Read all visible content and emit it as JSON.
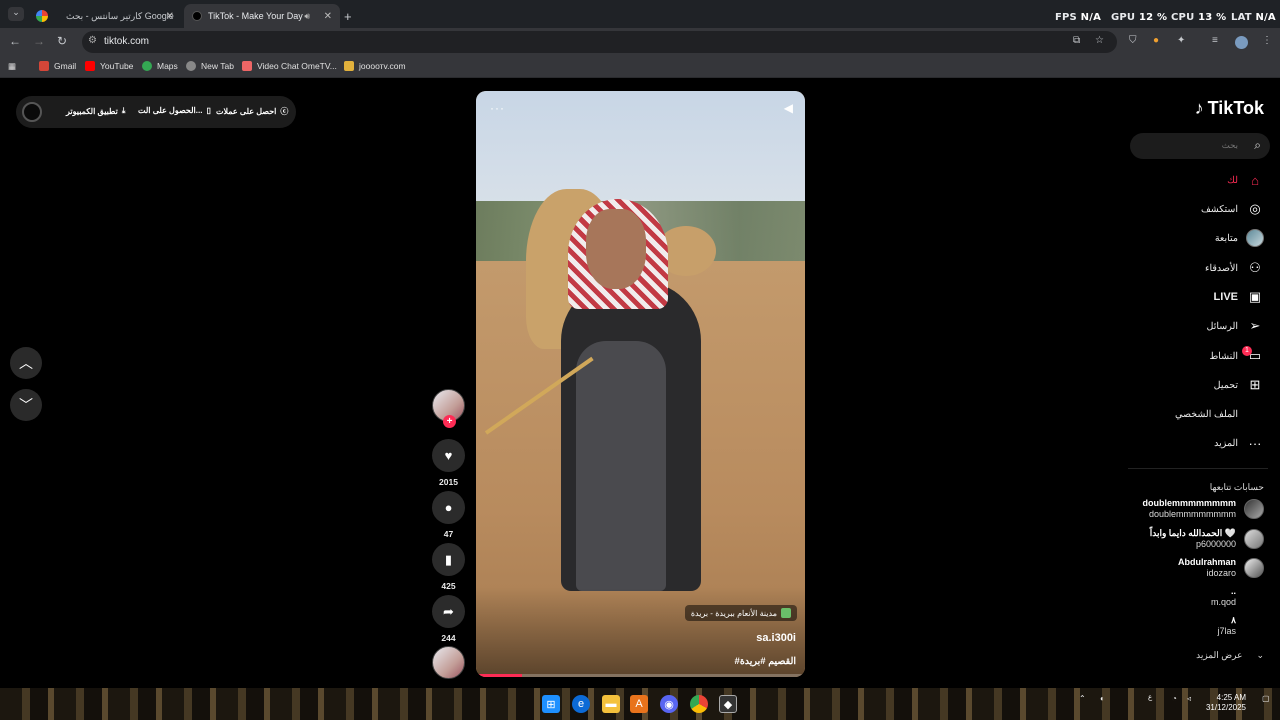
{
  "browser": {
    "tabs": [
      {
        "title": "کارتیر سانتس - بحث Google",
        "active": false
      },
      {
        "title": "TikTok - Make Your Day",
        "active": true
      }
    ],
    "new_tab": "+",
    "hud": {
      "fps_label": "FPS",
      "fps": "N/A",
      "gpu_label": "GPU",
      "gpu": "12 %",
      "cpu_label": "CPU",
      "cpu": "13 %",
      "lat_label": "LAT",
      "lat": "N/A"
    },
    "url": "tiktok.com",
    "bookmarks": [
      "Gmail",
      "YouTube",
      "Maps",
      "New Tab",
      "Video Chat OmeTV...",
      "joooотv.com"
    ]
  },
  "top_pill": {
    "get_coins": "احصل على عملات",
    "get_app": "الحصول على الت...",
    "desktop_app": "تطبيق الكمبيوتر"
  },
  "video": {
    "more": "···",
    "location": "مدينة الأنعام ببريدة - بريدة",
    "author": "sa.i300i",
    "caption": "#القصيم #بريدة",
    "progress": 0.14
  },
  "actions": {
    "likes": "2015",
    "comments": "47",
    "saves": "425",
    "shares": "244"
  },
  "sidebar": {
    "logo": "TikTok",
    "search_placeholder": "بحث",
    "items": [
      {
        "label": "لك",
        "icon": "home-icon"
      },
      {
        "label": "استكشف",
        "icon": "compass-icon"
      },
      {
        "label": "متابعة",
        "icon": "avatar"
      },
      {
        "label": "الأصدقاء",
        "icon": "friends-icon"
      },
      {
        "label": "LIVE",
        "icon": "live-icon"
      },
      {
        "label": "الرسائل",
        "icon": "send-icon"
      },
      {
        "label": "النشاط",
        "icon": "activity-icon",
        "badge": "1"
      },
      {
        "label": "تحميل",
        "icon": "upload-icon"
      },
      {
        "label": "الملف الشخصي",
        "icon": "profile-icon"
      },
      {
        "label": "المزيد",
        "icon": "more-icon"
      }
    ],
    "following_title": "حسابات تتابعها",
    "following": [
      {
        "name": "doublemmmmmmmm",
        "handle": "doublemmmmmmmm"
      },
      {
        "name": "الحمدالله دايما وابداً 🤍",
        "handle": "p6000000"
      },
      {
        "name": "Abdulrahman",
        "handle": "idozaro"
      },
      {
        "name": "..",
        "handle": "m.qod"
      },
      {
        "name": "٨",
        "handle": "j7las"
      }
    ],
    "see_more": "عرض المزيد"
  },
  "taskbar": {
    "time": "4:25 AM",
    "date": "31/12/2025",
    "lang": "ع"
  }
}
